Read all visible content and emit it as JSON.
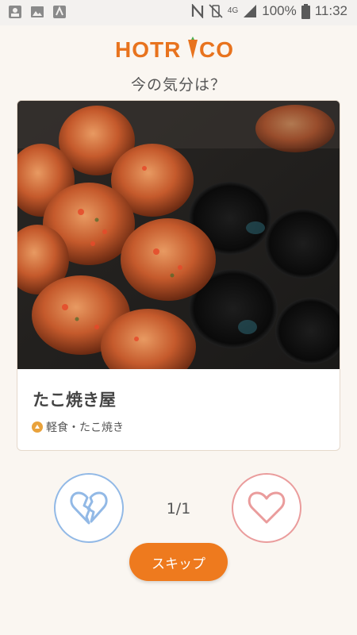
{
  "status_bar": {
    "network": "4G",
    "battery": "100%",
    "time": "11:32"
  },
  "brand": {
    "logo_text": "HOTRICO",
    "color": "#e8731e"
  },
  "prompt": "今の気分は？",
  "card": {
    "title": "たこ焼き屋",
    "category": "軽食・たこ焼き"
  },
  "counter": "1/1",
  "skip_label": "スキップ",
  "colors": {
    "background": "#faf6f1",
    "accent": "#ee7a1e",
    "dislike": "#92b9e6",
    "like": "#ea9c9c"
  }
}
